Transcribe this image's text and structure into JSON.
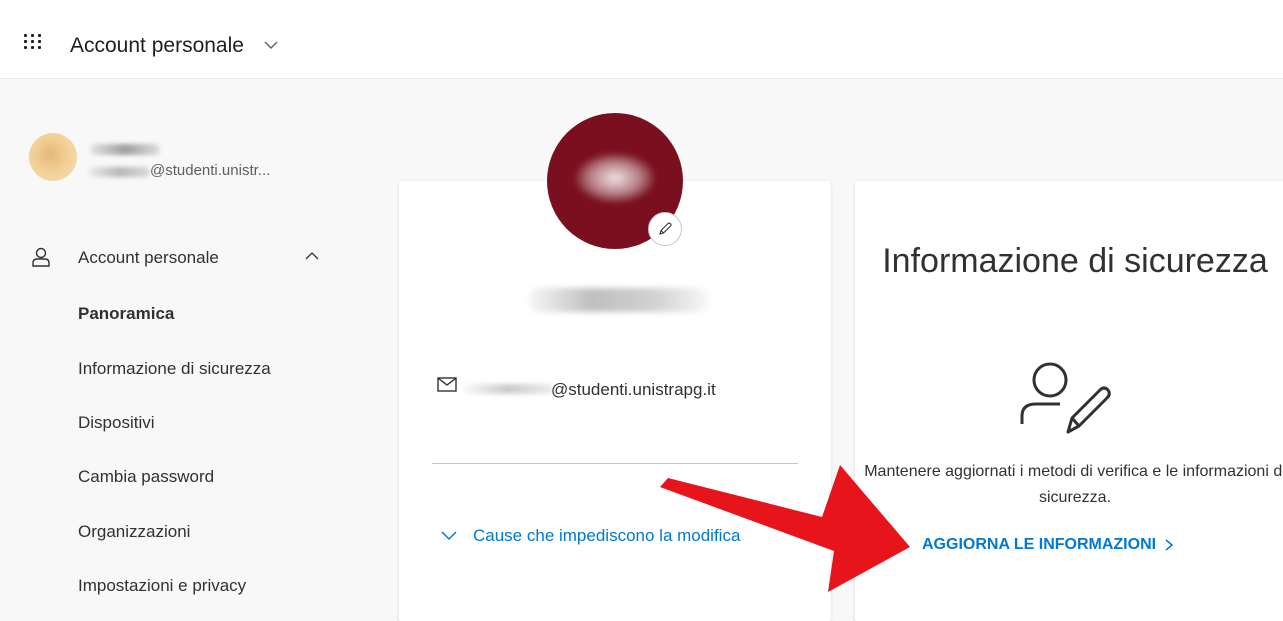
{
  "header": {
    "app_title": "Account personale",
    "waffle_icon": "app-launcher-icon",
    "title_chevron_icon": "chevron-down-icon"
  },
  "user": {
    "email": "@studenti.unistr..."
  },
  "sidebar": {
    "section_label": "Account personale",
    "section_icon": "person-icon",
    "collapse_icon": "chevron-up-icon",
    "items": [
      {
        "label": "Panoramica",
        "active": true
      },
      {
        "label": "Informazione di sicurezza",
        "active": false
      },
      {
        "label": "Dispositivi",
        "active": false
      },
      {
        "label": "Cambia password",
        "active": false
      },
      {
        "label": "Organizzazioni",
        "active": false
      },
      {
        "label": "Impostazioni e privacy",
        "active": false
      }
    ]
  },
  "profile_card": {
    "email": "@studenti.unistrapg.it",
    "email_icon": "mail-icon",
    "edit_icon": "pencil-icon",
    "why_link": "Cause che impediscono la modifica",
    "why_icon": "chevron-down-icon"
  },
  "security_card": {
    "title": "Informazione di sicurezza",
    "icon": "person-edit-icon",
    "description": "Mantenere aggiornati i metodi di verifica e le informazioni di sicurezza.",
    "link": "AGGIORNA LE INFORMAZIONI",
    "link_icon": "chevron-right-icon"
  },
  "colors": {
    "accent": "#0078d4",
    "photo": "#7a0f1f",
    "arrow": "#e8141b",
    "text": "#323130"
  }
}
